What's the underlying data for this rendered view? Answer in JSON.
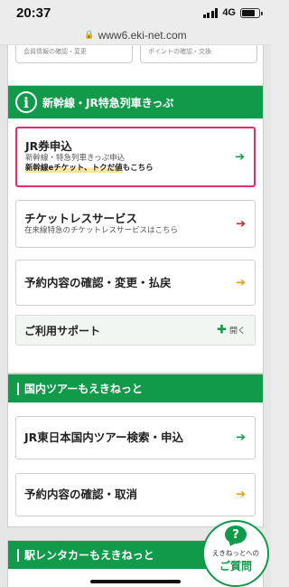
{
  "status": {
    "time": "20:37",
    "network": "4G"
  },
  "browser": {
    "url": "www6.eki-net.com"
  },
  "top_cards": [
    "会員情報の確認・変更",
    "ポイントの確認・交換"
  ],
  "shinkansen_section": {
    "title": "新幹線・JR特急列車きっぷ",
    "cards": [
      {
        "title": "JR券申込",
        "sub": "新幹線・特急列車きっぷ申込",
        "note_mark": "新幹線eチケット、トクだ値",
        "note_rest": "もこちら",
        "arrow": "green"
      },
      {
        "title": "チケットレスサービス",
        "sub": "在来線特急のチケットレスサービスはこちら",
        "arrow": "red"
      },
      {
        "title": "予約内容の確認・変更・払戻",
        "arrow": "orange"
      }
    ],
    "support": {
      "label": "ご利用サポート",
      "open_label": "開く"
    }
  },
  "tour_section": {
    "title": "国内ツアーもえきねっと",
    "cards": [
      {
        "title": "JR東日本国内ツアー検索・申込",
        "arrow": "green"
      },
      {
        "title": "予約内容の確認・取消",
        "arrow": "orange"
      }
    ]
  },
  "rental_section": {
    "title": "駅レンタカーもえきねっと"
  },
  "fab": {
    "icon": "?",
    "line1": "えきねっとへの",
    "line2": "ご質問"
  },
  "colors": {
    "brand_green": "#129a4b",
    "highlight_pink": "#e22c70",
    "arrow_red": "#cc2222",
    "arrow_orange": "#f09a10"
  }
}
